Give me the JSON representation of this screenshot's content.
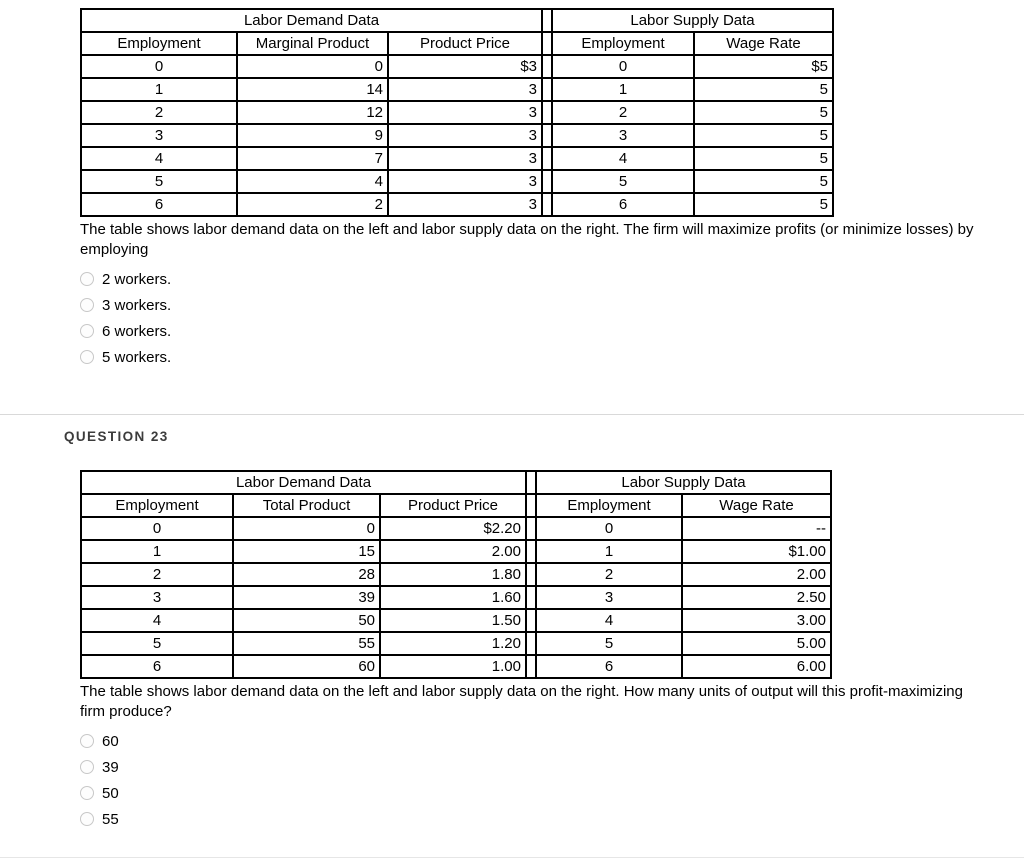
{
  "questions": [
    {
      "heading": null,
      "table": {
        "demand_group_title": "Labor Demand Data",
        "supply_group_title": "Labor Supply Data",
        "headers": {
          "employment": "Employment",
          "product": "Marginal Product",
          "price": "Product Price",
          "supply_employment": "Employment",
          "wage": "Wage Rate"
        },
        "rows": [
          {
            "employment": "0",
            "product": "0",
            "price": "$3",
            "supply_employment": "0",
            "wage": "$5"
          },
          {
            "employment": "1",
            "product": "14",
            "price": "3",
            "supply_employment": "1",
            "wage": "5"
          },
          {
            "employment": "2",
            "product": "12",
            "price": "3",
            "supply_employment": "2",
            "wage": "5"
          },
          {
            "employment": "3",
            "product": "9",
            "price": "3",
            "supply_employment": "3",
            "wage": "5"
          },
          {
            "employment": "4",
            "product": "7",
            "price": "3",
            "supply_employment": "4",
            "wage": "5"
          },
          {
            "employment": "5",
            "product": "4",
            "price": "3",
            "supply_employment": "5",
            "wage": "5"
          },
          {
            "employment": "6",
            "product": "2",
            "price": "3",
            "supply_employment": "6",
            "wage": "5"
          }
        ]
      },
      "prompt": "The table shows labor demand data on the left and labor supply data on the right. The firm will maximize profits (or minimize losses) by employing",
      "options": [
        {
          "label": "2 workers."
        },
        {
          "label": "3 workers."
        },
        {
          "label": "6 workers."
        },
        {
          "label": "5 workers."
        }
      ]
    },
    {
      "heading": "QUESTION 23",
      "table": {
        "demand_group_title": "Labor Demand Data",
        "supply_group_title": "Labor Supply Data",
        "headers": {
          "employment": "Employment",
          "product": "Total Product",
          "price": "Product Price",
          "supply_employment": "Employment",
          "wage": "Wage Rate"
        },
        "rows": [
          {
            "employment": "0",
            "product": "0",
            "price": "$2.20",
            "supply_employment": "0",
            "wage": "--"
          },
          {
            "employment": "1",
            "product": "15",
            "price": "2.00",
            "supply_employment": "1",
            "wage": "$1.00"
          },
          {
            "employment": "2",
            "product": "28",
            "price": "1.80",
            "supply_employment": "2",
            "wage": "2.00"
          },
          {
            "employment": "3",
            "product": "39",
            "price": "1.60",
            "supply_employment": "3",
            "wage": "2.50"
          },
          {
            "employment": "4",
            "product": "50",
            "price": "1.50",
            "supply_employment": "4",
            "wage": "3.00"
          },
          {
            "employment": "5",
            "product": "55",
            "price": "1.20",
            "supply_employment": "5",
            "wage": "5.00"
          },
          {
            "employment": "6",
            "product": "60",
            "price": "1.00",
            "supply_employment": "6",
            "wage": "6.00"
          }
        ]
      },
      "prompt": "The table shows labor demand data on the left and labor supply data on the right. How many units of output will this profit-maximizing firm produce?",
      "options": [
        {
          "label": "60"
        },
        {
          "label": "39"
        },
        {
          "label": "50"
        },
        {
          "label": "55"
        }
      ]
    }
  ]
}
